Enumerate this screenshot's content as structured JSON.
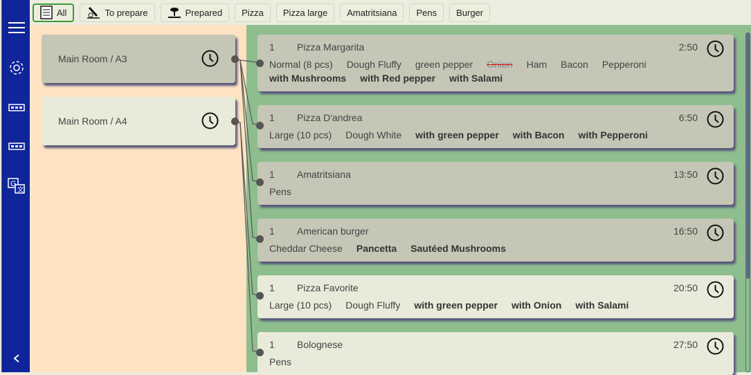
{
  "sidebar": {
    "items": [
      "menu-icon",
      "settings-icon",
      "orders-icon",
      "orders-alt-icon",
      "translate-icon",
      "collapse-icon"
    ]
  },
  "filters": [
    {
      "label": "All",
      "icon": "ticket-icon",
      "active": true
    },
    {
      "label": "To prepare",
      "icon": "prepare-icon"
    },
    {
      "label": "Prepared",
      "icon": "prepared-icon"
    },
    {
      "label": "Pizza"
    },
    {
      "label": "Pizza large"
    },
    {
      "label": "Amatritsiana"
    },
    {
      "label": "Pens"
    },
    {
      "label": "Burger"
    }
  ],
  "rooms": [
    {
      "label": "Main Room / A3"
    },
    {
      "label": "Main Room / A4"
    }
  ],
  "orders": [
    {
      "qty": "1",
      "name": "Pizza Margarita",
      "time": "2:50",
      "mods": [
        {
          "t": "Normal (8 pcs)"
        },
        {
          "t": "Dough Fluffy"
        },
        {
          "t": "green pepper"
        },
        {
          "t": "Onion",
          "s": "removed"
        },
        {
          "t": "Ham"
        },
        {
          "t": "Bacon"
        },
        {
          "t": "Pepperoni"
        },
        {
          "t": "with Mushrooms",
          "s": "added"
        },
        {
          "t": "with Red pepper",
          "s": "added"
        },
        {
          "t": "with Salami",
          "s": "added"
        }
      ]
    },
    {
      "qty": "1",
      "name": "Pizza D'andrea",
      "time": "6:50",
      "mods": [
        {
          "t": "Large (10 pcs)"
        },
        {
          "t": "Dough White"
        },
        {
          "t": "with green pepper",
          "s": "added"
        },
        {
          "t": "with Bacon",
          "s": "added"
        },
        {
          "t": "with Pepperoni",
          "s": "added"
        }
      ]
    },
    {
      "qty": "1",
      "name": "Amatritsiana",
      "time": "13:50",
      "mods": [
        {
          "t": "Pens"
        }
      ]
    },
    {
      "qty": "1",
      "name": "American burger",
      "time": "16:50",
      "mods": [
        {
          "t": "Cheddar Cheese"
        },
        {
          "t": "Pancetta",
          "s": "added"
        },
        {
          "t": "Sautéed Mushrooms",
          "s": "added"
        }
      ]
    },
    {
      "qty": "1",
      "name": "Pizza Favorite",
      "time": "20:50",
      "mods": [
        {
          "t": "Large (10 pcs)"
        },
        {
          "t": "Dough Fluffy"
        },
        {
          "t": "with green pepper",
          "s": "added"
        },
        {
          "t": "with Onion",
          "s": "added"
        },
        {
          "t": "with Salami",
          "s": "added"
        }
      ]
    },
    {
      "qty": "1",
      "name": "Bolognese",
      "time": "27:50",
      "mods": [
        {
          "t": "Pens"
        }
      ]
    }
  ]
}
